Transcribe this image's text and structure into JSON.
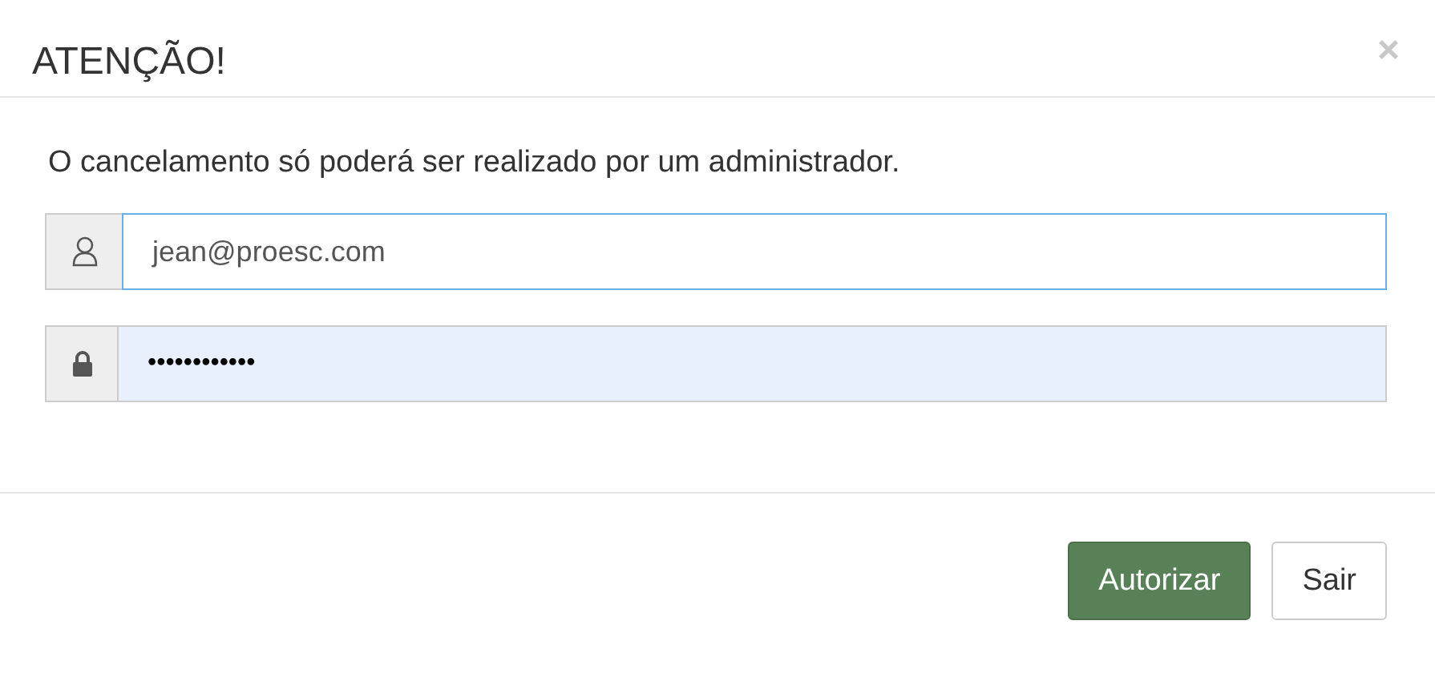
{
  "dialog": {
    "title": "ATENÇÃO!",
    "close": "×"
  },
  "message": "O cancelamento só poderá ser realizado por um administrador.",
  "fields": [
    {
      "kind": "user",
      "value": "jean@proesc.com",
      "focused": true,
      "autofilled": false
    },
    {
      "kind": "password",
      "value": "••••••••••••",
      "focused": false,
      "autofilled": true
    }
  ],
  "buttons": [
    {
      "label": "Autorizar",
      "kind": "primary"
    },
    {
      "label": "Sair",
      "kind": "default"
    }
  ]
}
